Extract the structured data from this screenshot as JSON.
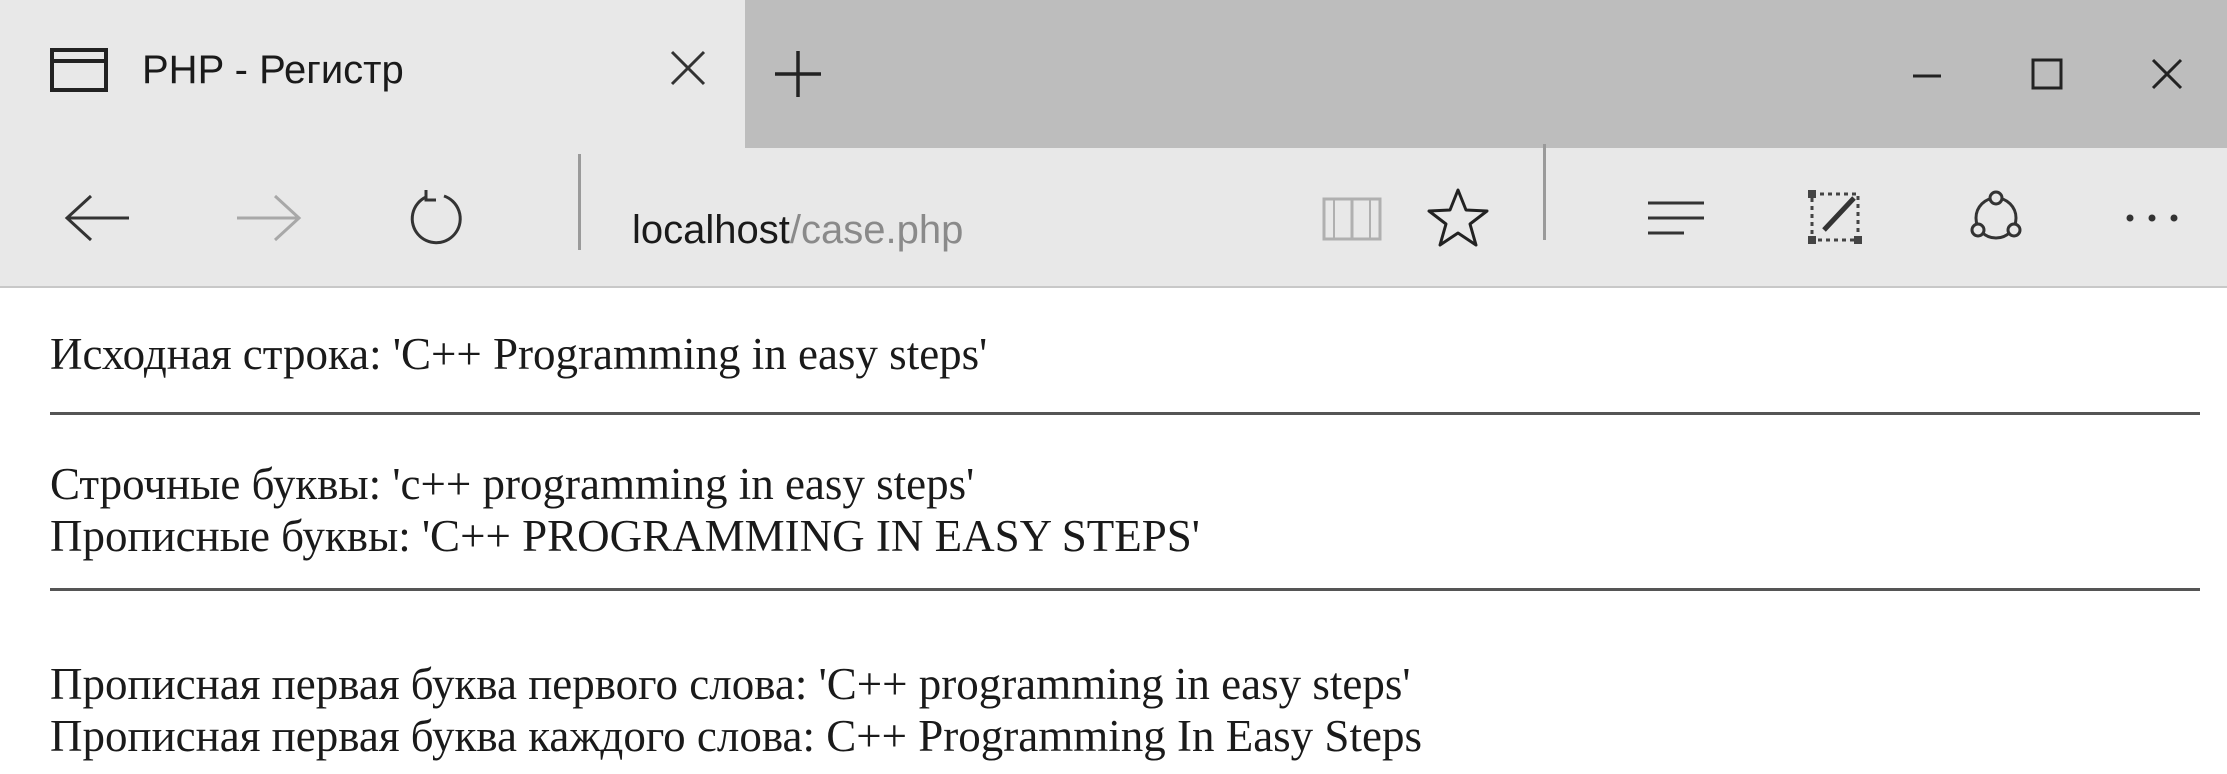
{
  "tab": {
    "title": "PHP - Регистр",
    "icon": "page-icon"
  },
  "window_controls": {
    "minimize": "minimize-icon",
    "maximize": "maximize-icon",
    "close": "close-icon"
  },
  "navbar": {
    "address_host": "localhost",
    "address_path": "/case.php"
  },
  "content": {
    "original": "Исходная строка: 'C++ Programming in easy steps'",
    "lowercase": "Строчные буквы: 'c++ programming in easy steps'",
    "uppercase": "Прописные буквы: 'C++ PROGRAMMING IN EASY STEPS'",
    "ucfirst": "Прописная первая буква первого слова: 'C++ programming in easy steps'",
    "ucwords": "Прописная первая буква каждого слова: C++ Programming In Easy Steps"
  }
}
